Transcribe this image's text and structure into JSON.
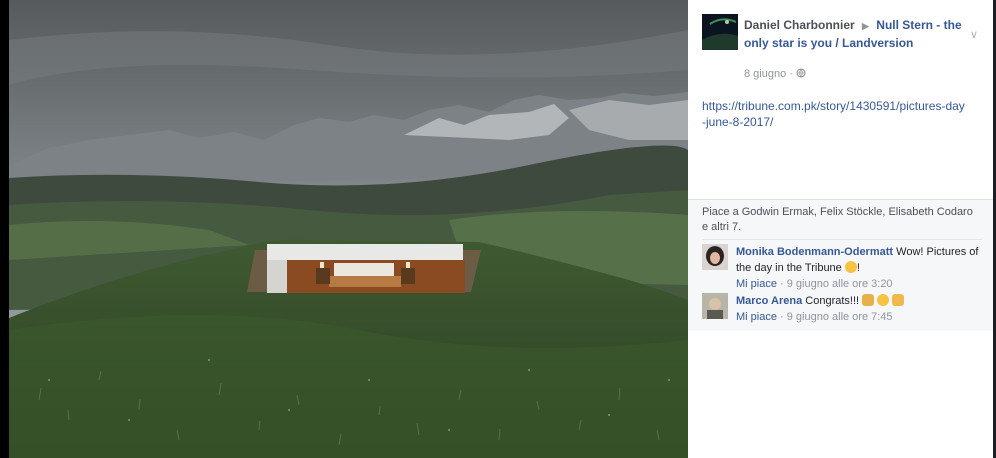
{
  "post": {
    "author": "Daniel Charbonnier",
    "arrow": "▶",
    "target": "Null Stern - the only star is you / Landversion",
    "date": "8 giugno",
    "dot": " · ",
    "privacy_icon": "globe-icon",
    "menu_icon": "chevron-down-icon",
    "link": "https://tribune.com.pk/story/1430591/pictures-day-june-8-2017/"
  },
  "reactions": {
    "likes_text": "Piace a Godwin Ermak, Felix Stöckle, Elisabeth Codaro e altri 7."
  },
  "comments": [
    {
      "name": "Monika Bodenmann-Odermatt",
      "text": "Wow! Pictures of the day in the Tribune",
      "emoji": "heart-eyes-emoji",
      "suffix": "!",
      "like_label": "Mi piace",
      "time": " · 9 giugno alle ore 3:20"
    },
    {
      "name": "Marco Arena",
      "text": "Congrats!!!",
      "emoji": "man-emoji, sunglasses-emoji, rock-hand-emoji",
      "like_label": "Mi piace",
      "time": " · 9 giugno alle ore 7:45"
    }
  ],
  "colors": {
    "link": "#365899",
    "meta": "#90949c",
    "likes_bg": "#f6f7f9"
  }
}
